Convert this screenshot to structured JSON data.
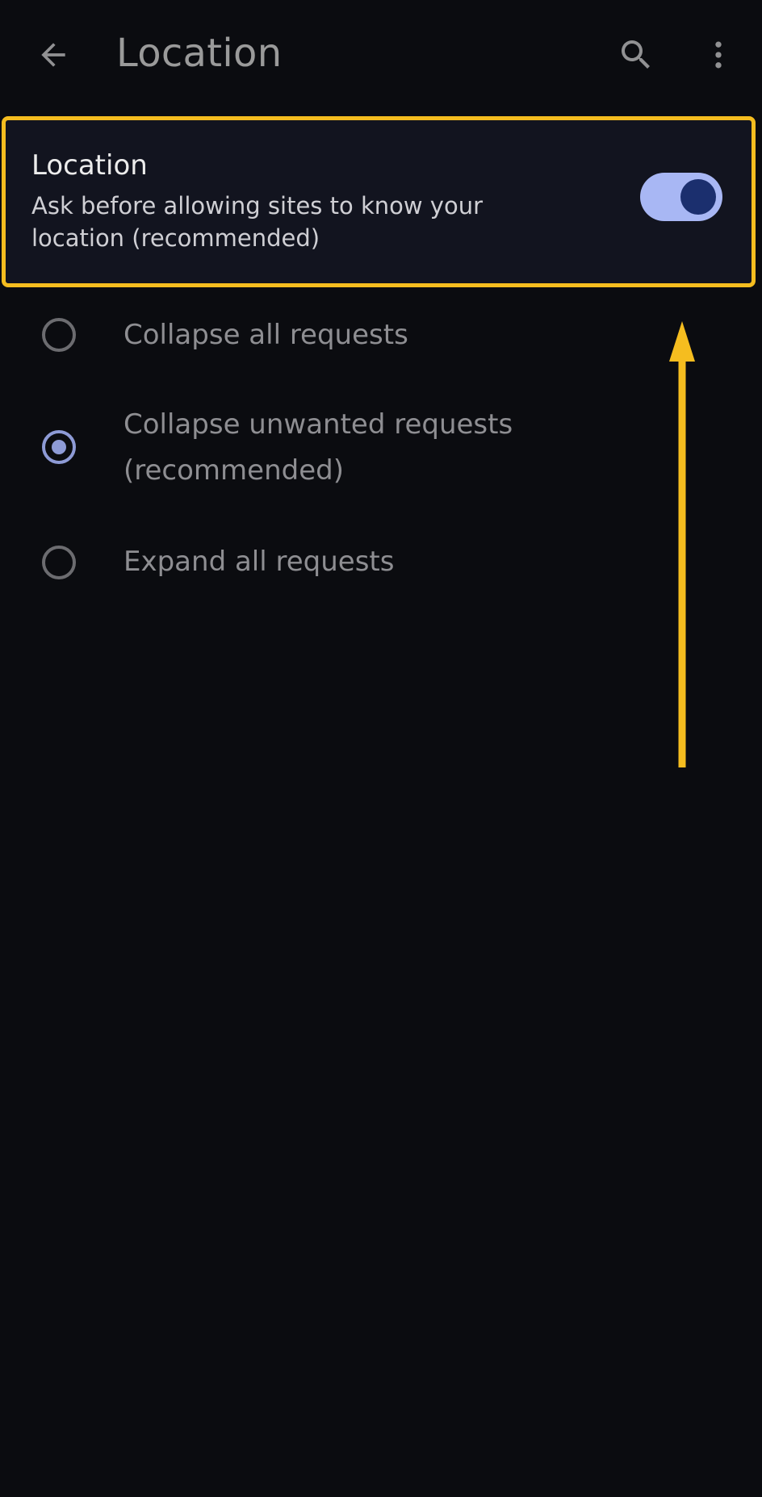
{
  "appbar": {
    "title": "Location",
    "back_icon": "arrow-back-icon",
    "search_icon": "search-icon",
    "more_icon": "more-vert-icon"
  },
  "setting": {
    "title": "Location",
    "description": "Ask before allowing sites to know your location (recommended)",
    "toggle_on": true
  },
  "options": [
    {
      "label": "Collapse all requests",
      "selected": false
    },
    {
      "label": "Collapse unwanted requests (recommended)",
      "selected": true
    },
    {
      "label": "Expand all requests",
      "selected": false
    }
  ],
  "colors": {
    "background": "#0b0c10",
    "highlight": "#f5bd1f",
    "toggle_track": "#a8b7f4",
    "toggle_knob": "#1b2f6e",
    "radio_selected": "#8e9bd6"
  },
  "annotation": {
    "arrow_icon": "arrow-up-icon"
  }
}
